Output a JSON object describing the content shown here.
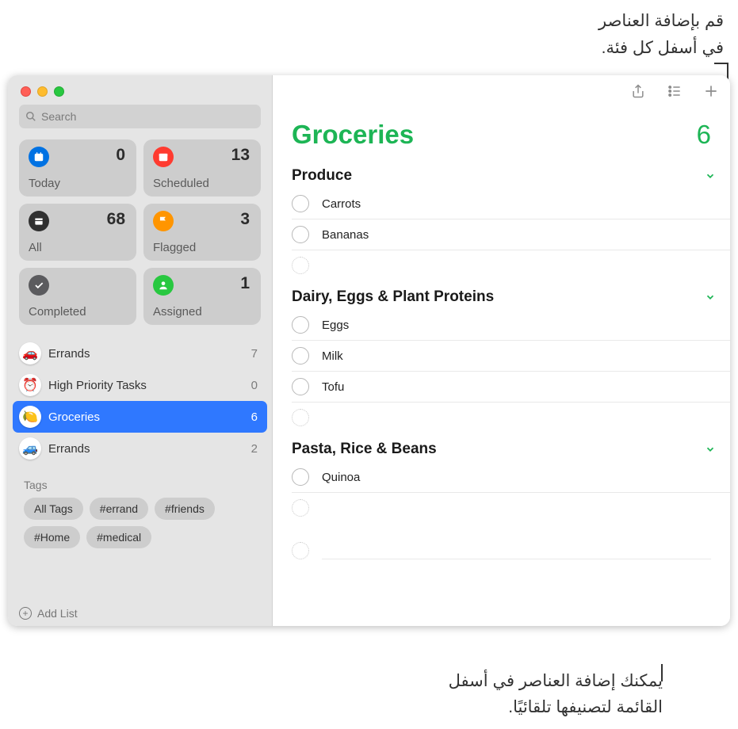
{
  "callouts": {
    "top_line1": "قم بإضافة العناصر",
    "top_line2": "في أسفل كل فئة.",
    "bottom_line1": "يمكنك إضافة العناصر في أسفل",
    "bottom_line2": "القائمة لتصنيفها تلقائيًا."
  },
  "search": {
    "placeholder": "Search"
  },
  "smart": {
    "today": {
      "label": "Today",
      "count": "0"
    },
    "scheduled": {
      "label": "Scheduled",
      "count": "13"
    },
    "all": {
      "label": "All",
      "count": "68"
    },
    "flagged": {
      "label": "Flagged",
      "count": "3"
    },
    "completed": {
      "label": "Completed",
      "count": ""
    },
    "assigned": {
      "label": "Assigned",
      "count": "1"
    }
  },
  "lists": [
    {
      "name": "Errands",
      "count": "7",
      "emoji": "🚗"
    },
    {
      "name": "High Priority Tasks",
      "count": "0",
      "emoji": "⏰"
    },
    {
      "name": "Groceries",
      "count": "6",
      "emoji": "🍋"
    },
    {
      "name": "Errands",
      "count": "2",
      "emoji": "🚙"
    }
  ],
  "tags": {
    "header": "Tags",
    "items": [
      "All Tags",
      "#errand",
      "#friends",
      "#Home",
      "#medical"
    ]
  },
  "add_list": "Add List",
  "main": {
    "title": "Groceries",
    "count": "6",
    "sections": [
      {
        "title": "Produce",
        "items": [
          "Carrots",
          "Bananas"
        ]
      },
      {
        "title": "Dairy, Eggs & Plant Proteins",
        "items": [
          "Eggs",
          "Milk",
          "Tofu"
        ]
      },
      {
        "title": "Pasta, Rice & Beans",
        "items": [
          "Quinoa"
        ]
      }
    ]
  }
}
